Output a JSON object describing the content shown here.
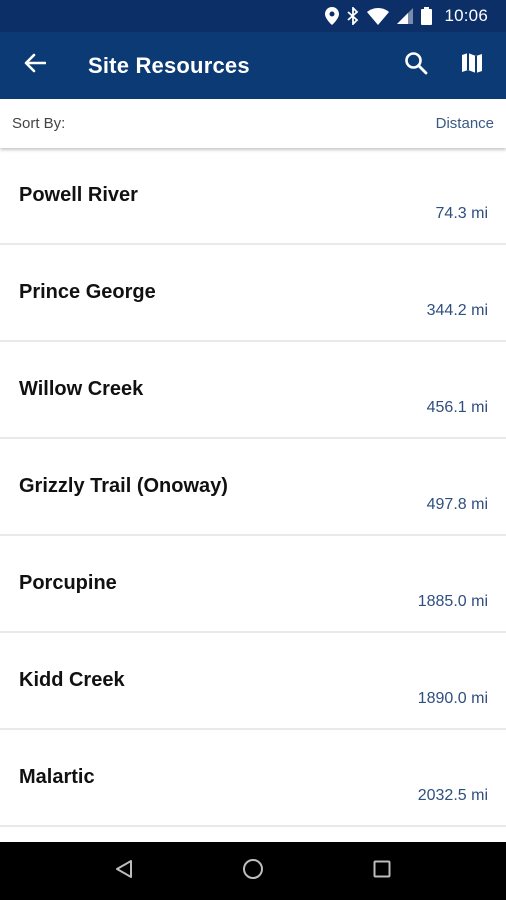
{
  "status_bar": {
    "time": "10:06",
    "icons": [
      "location-icon",
      "bluetooth-icon",
      "wifi-icon",
      "cell-signal-icon",
      "battery-icon"
    ]
  },
  "app_bar": {
    "title": "Site Resources",
    "icons": [
      "back-arrow-icon",
      "search-icon",
      "map-icon"
    ],
    "color": "#0b3a75"
  },
  "sort": {
    "label": "Sort By:",
    "value": "Distance"
  },
  "sites": [
    {
      "name": "Powell River",
      "distance": "74.3 mi"
    },
    {
      "name": "Prince George",
      "distance": "344.2 mi"
    },
    {
      "name": "Willow Creek",
      "distance": "456.1 mi"
    },
    {
      "name": "Grizzly Trail (Onoway)",
      "distance": "497.8 mi"
    },
    {
      "name": "Porcupine",
      "distance": "1885.0 mi"
    },
    {
      "name": "Kidd Creek",
      "distance": "1890.0 mi"
    },
    {
      "name": "Malartic",
      "distance": "2032.5 mi"
    }
  ],
  "nav_bar": {
    "icons": [
      "back-triangle-icon",
      "home-circle-icon",
      "recents-square-icon"
    ]
  }
}
